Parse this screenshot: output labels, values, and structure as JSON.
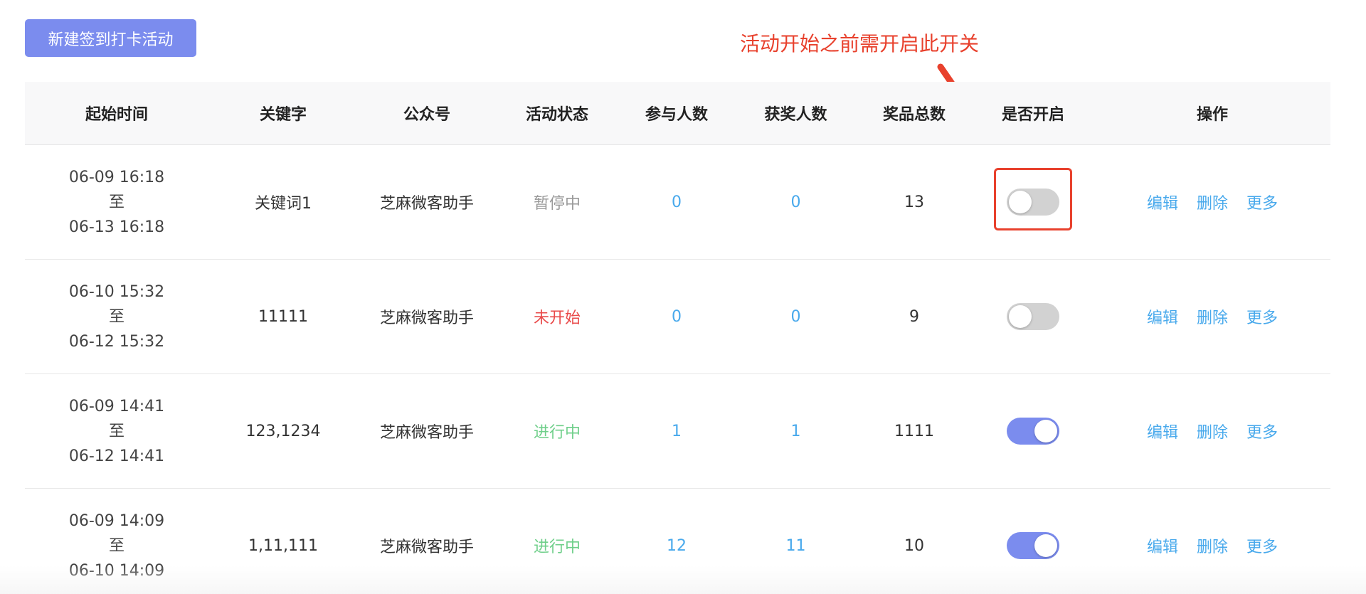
{
  "toolbar": {
    "new_button_label": "新建签到打卡活动"
  },
  "annotation": {
    "text": "活动开始之前需开启此开关",
    "color": "#e8412d"
  },
  "colors": {
    "accent": "#7b8cee",
    "link": "#48a9ec",
    "status_paused": "#999999",
    "status_pending": "#e94b4b",
    "status_active": "#6fcf8a"
  },
  "table": {
    "headers": [
      "起始时间",
      "关键字",
      "公众号",
      "活动状态",
      "参与人数",
      "获奖人数",
      "奖品总数",
      "是否开启",
      "操作"
    ],
    "rows": [
      {
        "start": "06-09 16:18",
        "separator": "至",
        "end": "06-13 16:18",
        "keyword": "关键词1",
        "account": "芝麻微客助手",
        "status": "暂停中",
        "participants": "0",
        "winners": "0",
        "prizes": "13",
        "enabled": false,
        "ops": [
          "编辑",
          "删除",
          "更多"
        ]
      },
      {
        "start": "06-10 15:32",
        "separator": "至",
        "end": "06-12 15:32",
        "keyword": "11111",
        "account": "芝麻微客助手",
        "status": "未开始",
        "participants": "0",
        "winners": "0",
        "prizes": "9",
        "enabled": false,
        "ops": [
          "编辑",
          "删除",
          "更多"
        ]
      },
      {
        "start": "06-09 14:41",
        "separator": "至",
        "end": "06-12 14:41",
        "keyword": "123,1234",
        "account": "芝麻微客助手",
        "status": "进行中",
        "participants": "1",
        "winners": "1",
        "prizes": "1111",
        "enabled": true,
        "ops": [
          "编辑",
          "删除",
          "更多"
        ]
      },
      {
        "start": "06-09 14:09",
        "separator": "至",
        "end": "06-10 14:09",
        "keyword": "1,11,111",
        "account": "芝麻微客助手",
        "status": "进行中",
        "participants": "12",
        "winners": "11",
        "prizes": "10",
        "enabled": true,
        "ops": [
          "编辑",
          "删除",
          "更多"
        ]
      }
    ]
  }
}
